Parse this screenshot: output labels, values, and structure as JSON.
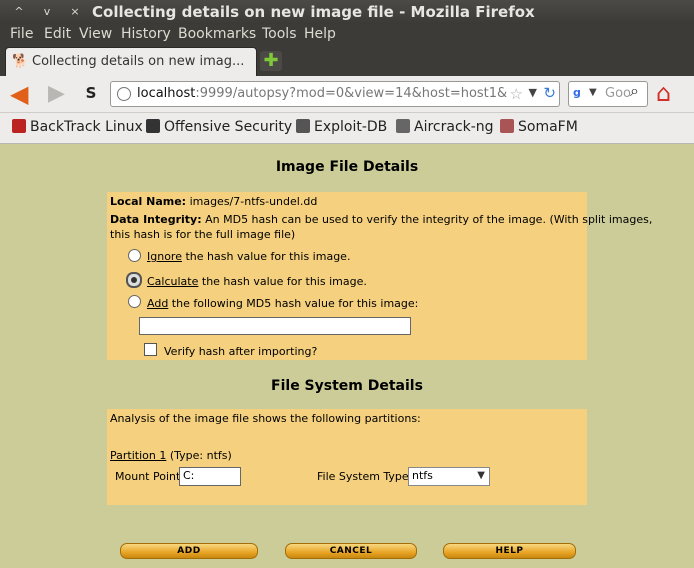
{
  "window": {
    "title": "Collecting details on new image file - Mozilla Firefox"
  },
  "menu": [
    "File",
    "Edit",
    "View",
    "History",
    "Bookmarks",
    "Tools",
    "Help"
  ],
  "tab": {
    "label": "Collecting details on new imag..."
  },
  "nav": {
    "url_host": "localhost",
    "url_rest": ":9999/autopsy?mod=0&view=14&host=host1&",
    "search_placeholder": "Goo"
  },
  "bookmarks": [
    "BackTrack Linux",
    "Offensive Security",
    "Exploit-DB",
    "Aircrack-ng",
    "SomaFM"
  ],
  "image_details": {
    "heading": "Image File Details",
    "local_name_label": "Local Name:",
    "local_name_value": "images/7-ntfs-undel.dd",
    "integrity_label": "Data Integrity:",
    "integrity_text_1": "An MD5 hash can be used to verify the integrity of the image. (With split images,",
    "integrity_text_2": "this hash is for the full image file)",
    "opt_ignore_key": "Ignore",
    "opt_ignore_rest": "the hash value for this image.",
    "opt_calc_key": "Calculate",
    "opt_calc_rest": "the hash value for this image.",
    "opt_add_key": "Add",
    "opt_add_rest": "the following MD5 hash value for this image:",
    "md5_value": "",
    "verify_label": "Verify hash after importing?"
  },
  "fs_details": {
    "heading": "File System Details",
    "analysis_text": "Analysis of the image file shows the following partitions:",
    "partition_link": "Partition 1",
    "partition_type": "(Type: ntfs)",
    "mount_label": "Mount Point:",
    "mount_value": "C:",
    "fstype_label": "File System Type:",
    "fstype_value": "ntfs"
  },
  "buttons": {
    "add": "ADD",
    "cancel": "CANCEL",
    "help": "HELP"
  }
}
